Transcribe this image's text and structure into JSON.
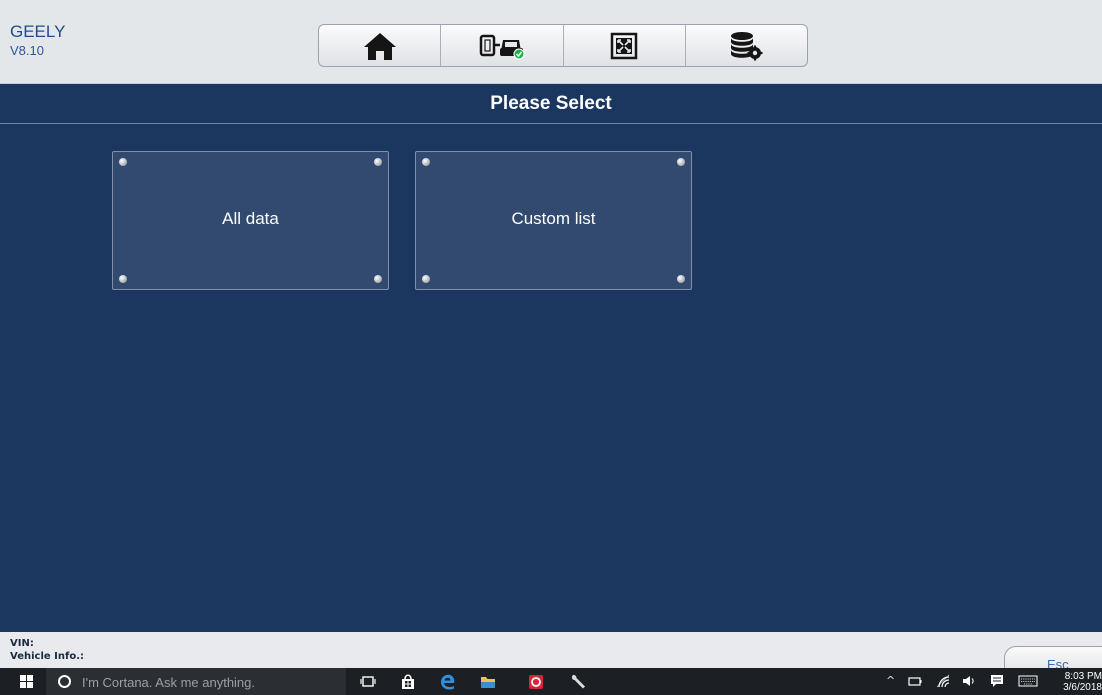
{
  "app": {
    "brand": "GEELY",
    "version": "V8.10"
  },
  "toolbar": {
    "buttons": [
      {
        "icon": "home-icon"
      },
      {
        "icon": "device-vehicle-connection-icon"
      },
      {
        "icon": "fullscreen-icon"
      },
      {
        "icon": "database-settings-icon"
      }
    ]
  },
  "page": {
    "title": "Please Select"
  },
  "options": [
    {
      "label": "All data"
    },
    {
      "label": "Custom list"
    }
  ],
  "footer": {
    "vin_label": "VIN:",
    "vehicle_info_label": "Vehicle Info.:",
    "esc_label": "Esc"
  },
  "taskbar": {
    "search_placeholder": "I'm Cortana. Ask me anything.",
    "time": "8:03 PM",
    "date": "3/6/2018"
  },
  "colors": {
    "background": "#1b365f",
    "tile": "#324a70",
    "header": "#e4e7ea",
    "brand": "#1f4b8f"
  }
}
